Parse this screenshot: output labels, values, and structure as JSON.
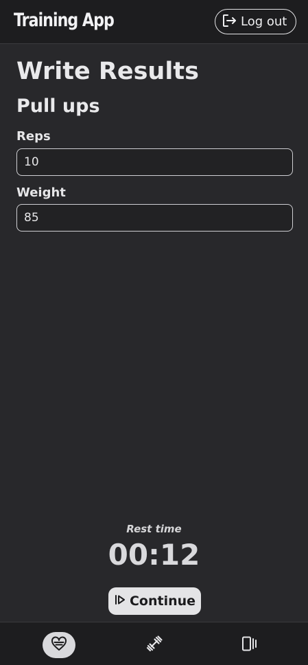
{
  "header": {
    "app_title": "Training App",
    "logout_label": "Log out",
    "logout_icon": "logout-icon"
  },
  "main": {
    "page_title": "Write Results",
    "exercise_name": "Pull ups",
    "fields": [
      {
        "label": "Reps",
        "value": "10"
      },
      {
        "label": "Weight",
        "value": "85"
      }
    ]
  },
  "rest": {
    "label": "Rest time",
    "time": "00:12"
  },
  "continue": {
    "label": "Continue",
    "icon": "play-skip-icon"
  },
  "bottom_nav": {
    "items": [
      {
        "icon": "heart-icon",
        "active": true
      },
      {
        "icon": "dumbbell-icon",
        "active": false
      },
      {
        "icon": "cards-icon",
        "active": false
      }
    ]
  },
  "colors": {
    "background": "#28282b",
    "header_background": "#1d1d1f",
    "text": "#e8e8ea",
    "button_background": "#e4e4e6"
  }
}
